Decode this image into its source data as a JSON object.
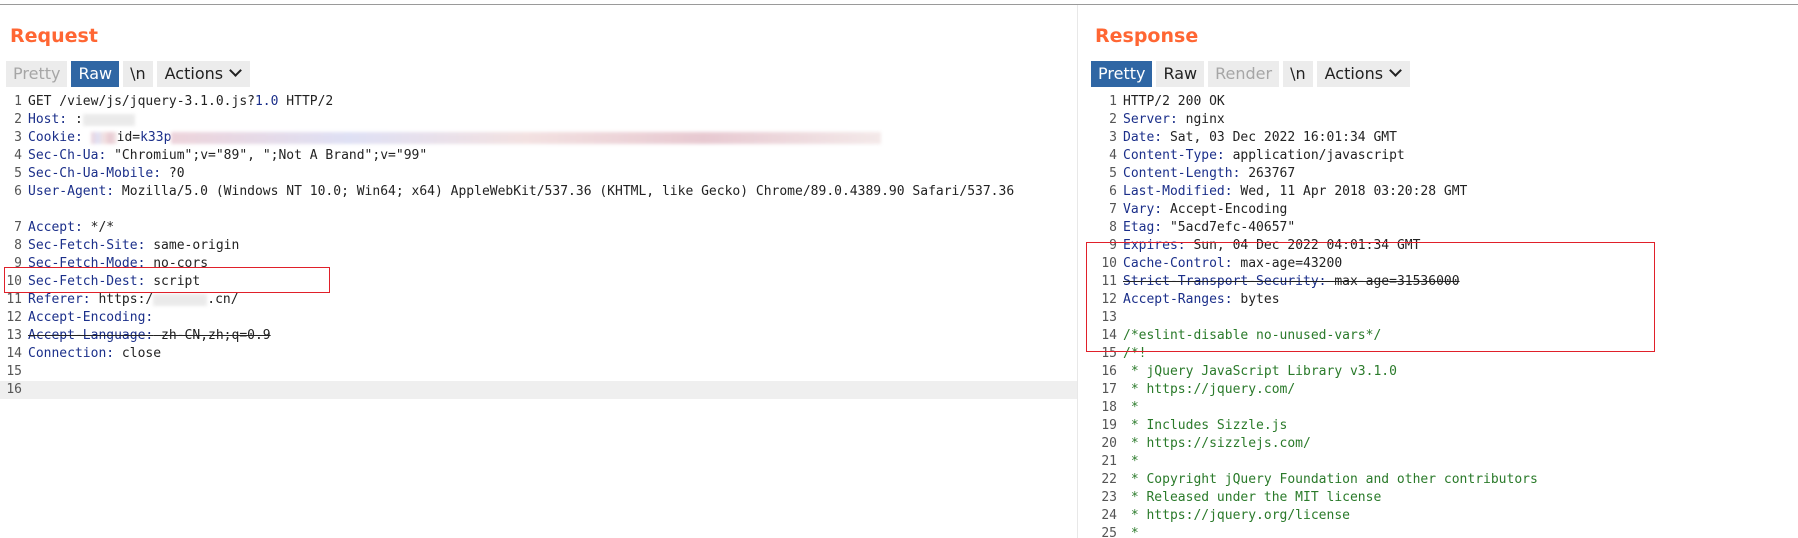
{
  "request": {
    "title": "Request",
    "toolbar": {
      "pretty": "Pretty",
      "raw": "Raw",
      "newline": "\\n",
      "actions": "Actions",
      "active": "Raw"
    },
    "lines": [
      {
        "n": "1",
        "request_line": [
          "GET /view/js/jquery-3.1.0.js?",
          "1.0",
          " HTTP/2"
        ]
      },
      {
        "n": "2",
        "name": "Host:",
        "value": " :"
      },
      {
        "n": "3",
        "name": "Cookie:",
        "value_prefix": " ",
        "param": "id",
        "eq": "=",
        "param_value": "k33p",
        "redacted": true
      },
      {
        "n": "4",
        "name": "Sec-Ch-Ua:",
        "value": " \"Chromium\";v=\"89\", \";Not A Brand\";v=\"99\""
      },
      {
        "n": "5",
        "name": "Sec-Ch-Ua-Mobile:",
        "value": " ?0"
      },
      {
        "n": "6",
        "name": "User-Agent:",
        "value": " Mozilla/5.0 (Windows NT 10.0; Win64; x64) AppleWebKit/537.36 (KHTML, like Gecko) Chrome/89.0.4389.90 Safari/537.36"
      },
      {
        "n": "7",
        "name": "Accept:",
        "value": " */*"
      },
      {
        "n": "8",
        "name": "Sec-Fetch-Site:",
        "value": " same-origin"
      },
      {
        "n": "9",
        "name": "Sec-Fetch-Mode:",
        "value": " no-cors"
      },
      {
        "n": "10",
        "name": "Sec-Fetch-Dest:",
        "value": " script"
      },
      {
        "n": "11",
        "name": "Referer:",
        "value": " https:/",
        "value_tail": ".cn/"
      },
      {
        "n": "12",
        "name": "Accept-Encoding:",
        "value": ""
      },
      {
        "n": "13",
        "name": "Accept-Language:",
        "value": " zh-CN,zh;q=0.9"
      },
      {
        "n": "14",
        "name": "Connection:",
        "value": " close"
      },
      {
        "n": "15"
      },
      {
        "n": "16"
      }
    ]
  },
  "response": {
    "title": "Response",
    "toolbar": {
      "pretty": "Pretty",
      "raw": "Raw",
      "render": "Render",
      "newline": "\\n",
      "actions": "Actions",
      "active": "Pretty"
    },
    "lines": [
      {
        "n": "1",
        "plain": "HTTP/2 200 OK"
      },
      {
        "n": "2",
        "name": "Server:",
        "value": " nginx"
      },
      {
        "n": "3",
        "name": "Date:",
        "value": " Sat, 03 Dec 2022 16:01:34 GMT"
      },
      {
        "n": "4",
        "name": "Content-Type:",
        "value": " application/javascript"
      },
      {
        "n": "5",
        "name": "Content-Length:",
        "value": " 263767"
      },
      {
        "n": "6",
        "name": "Last-Modified:",
        "value": " Wed, 11 Apr 2018 03:20:28 GMT"
      },
      {
        "n": "7",
        "name": "Vary:",
        "value": " Accept-Encoding"
      },
      {
        "n": "8",
        "name": "Etag:",
        "value": " \"5acd7efc-40657\""
      },
      {
        "n": "9",
        "name": "Expires:",
        "value": " Sun, 04 Dec 2022 04:01:34 GMT"
      },
      {
        "n": "10",
        "name": "Cache-Control:",
        "value": " max-age=43200"
      },
      {
        "n": "11",
        "name": "Strict-Transport-Security:",
        "value": " max-age=31536000"
      },
      {
        "n": "12",
        "name": "Accept-Ranges:",
        "value": " bytes"
      },
      {
        "n": "13"
      },
      {
        "n": "14",
        "comment": "/*eslint-disable no-unused-vars*/"
      },
      {
        "n": "15",
        "comment": "/*!"
      },
      {
        "n": "16",
        "comment": " * jQuery JavaScript Library v3.1.0"
      },
      {
        "n": "17",
        "comment": " * https://jquery.com/"
      },
      {
        "n": "18",
        "comment": " *"
      },
      {
        "n": "19",
        "comment": " * Includes Sizzle.js"
      },
      {
        "n": "20",
        "comment": " * https://sizzlejs.com/"
      },
      {
        "n": "21",
        "comment": " *"
      },
      {
        "n": "22",
        "comment": " * Copyright jQuery Foundation and other contributors"
      },
      {
        "n": "23",
        "comment": " * Released under the MIT license"
      },
      {
        "n": "24",
        "comment": " * https://jquery.org/license"
      },
      {
        "n": "25",
        "comment": " *"
      }
    ]
  },
  "colors": {
    "title": "#ff6633",
    "active_tab": "#2f66a4",
    "header_name": "#1b2f8a",
    "comment": "#2a7a2a",
    "highlight_box": "#e0202a"
  }
}
